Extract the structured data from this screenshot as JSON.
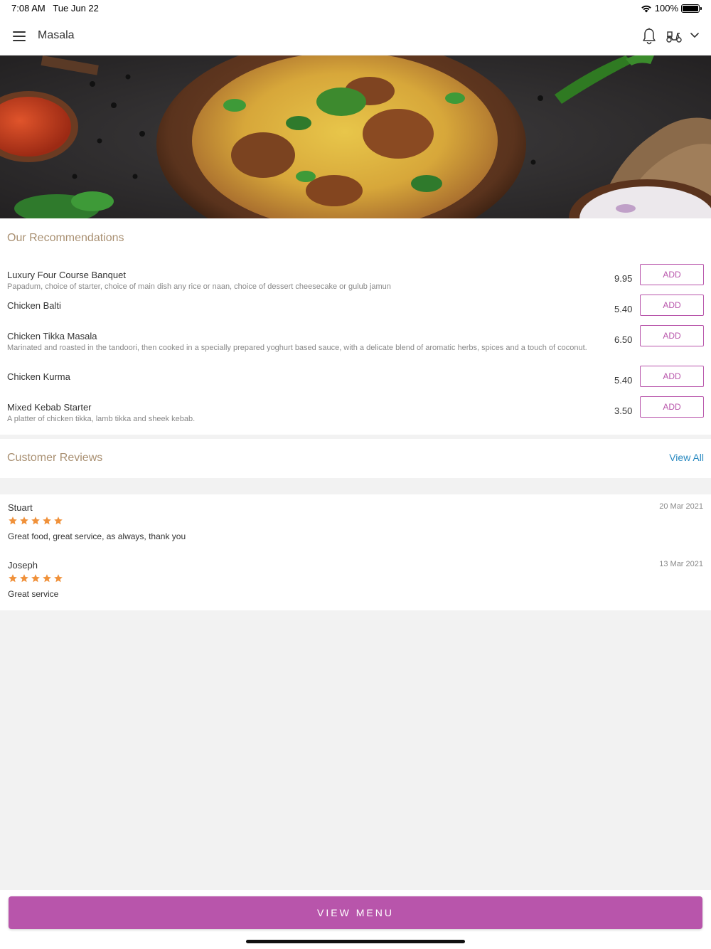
{
  "status_bar": {
    "time": "7:08 AM",
    "date": "Tue Jun 22",
    "battery": "100%"
  },
  "header": {
    "title": "Masala"
  },
  "hero": {
    "alt": "food-banner"
  },
  "recommendations": {
    "title": "Our Recommendations",
    "add_label": "ADD",
    "items": [
      {
        "name": "Luxury Four Course Banquet",
        "description": "Papadum, choice of starter, choice of main dish any rice or naan, choice of dessert cheesecake or gulub jamun",
        "price": "9.95"
      },
      {
        "name": "Chicken Balti",
        "description": "",
        "price": "5.40"
      },
      {
        "name": "Chicken Tikka Masala",
        "description": "Marinated and roasted in the tandoori, then cooked in a specially prepared yoghurt based sauce, with a delicate blend of aromatic herbs, spices and a touch of coconut.",
        "price": "6.50"
      },
      {
        "name": "Chicken Kurma",
        "description": "",
        "price": "5.40"
      },
      {
        "name": "Mixed Kebab Starter",
        "description": "A platter of chicken tikka, lamb tikka and sheek kebab.",
        "price": "3.50"
      }
    ]
  },
  "reviews": {
    "title": "Customer Reviews",
    "view_all": "View All",
    "items": [
      {
        "name": "Stuart",
        "date": "20 Mar 2021",
        "rating": 5,
        "text": "Great food, great service, as always, thank you"
      },
      {
        "name": "Joseph",
        "date": "13 Mar 2021",
        "rating": 5,
        "text": "Great service"
      }
    ]
  },
  "footer": {
    "button_label": "VIEW MENU"
  },
  "colors": {
    "accent": "#b855ab",
    "section_title": "#a99072",
    "link": "#2a8ac1",
    "star": "#f0913a"
  }
}
